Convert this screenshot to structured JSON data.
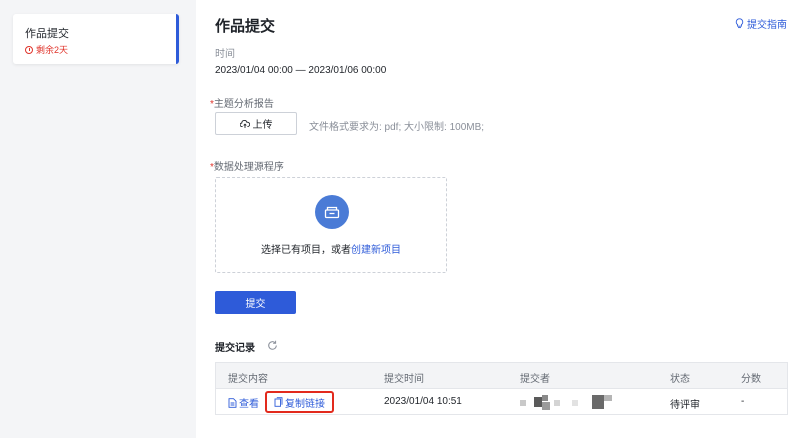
{
  "sidebar": {
    "item_title": "作品提交",
    "item_remaining": "剩余2天"
  },
  "header": {
    "title": "作品提交",
    "guide_link": "提交指南"
  },
  "time": {
    "label": "时间",
    "range": "2023/01/04 00:00 — 2023/01/06 00:00"
  },
  "report": {
    "required_mark": "*",
    "label": "主题分析报告",
    "upload_button": "上传",
    "upload_hint": "文件格式要求为: pdf; 大小限制: 100MB;"
  },
  "program": {
    "required_mark": "*",
    "label": "数据处理源程序",
    "prompt_text": "选择已有项目，或者",
    "create_link": "创建新项目"
  },
  "submit_button": "提交",
  "records": {
    "title": "提交记录",
    "columns": [
      "提交内容",
      "提交时间",
      "提交者",
      "状态",
      "分数"
    ],
    "rows": [
      {
        "view_label": "查看",
        "copy_label": "复制链接",
        "time": "2023/01/04 10:51",
        "status": "待评审",
        "score": "-"
      }
    ]
  },
  "colors": {
    "accent": "#2e5bd9",
    "danger": "#e0342b",
    "highlight_box": "#e22a1d"
  }
}
